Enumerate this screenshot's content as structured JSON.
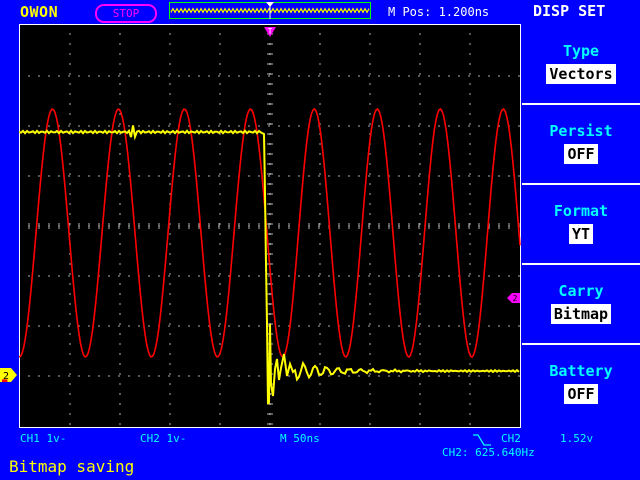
{
  "header": {
    "brand": "OWON",
    "run_status": "STOP",
    "m_pos": "M Pos: 1.200ns",
    "menu_title": "DISP SET"
  },
  "menu": [
    {
      "label": "Type",
      "value": "Vectors"
    },
    {
      "label": "Persist",
      "value": "OFF"
    },
    {
      "label": "Format",
      "value": "YT"
    },
    {
      "label": "Carry",
      "value": "Bitmap"
    },
    {
      "label": "Battery",
      "value": "OFF"
    }
  ],
  "status_bar": {
    "ch1": "CH1 1v-",
    "ch2": "CH2 1v-",
    "timebase": "M  50ns",
    "trigger_source": "CH2",
    "trigger_level": "1.52v",
    "frequency": "CH2: 625.640Hz"
  },
  "message": "Bitmap saving",
  "markers": {
    "trigger_marker": "T",
    "ch2_level_marker": "2",
    "ch2_ground_marker": "2"
  },
  "colors": {
    "background": "#0000ff",
    "screen": "#000000",
    "ch1_trace": "#ffff00",
    "ch2_trace": "#ff0000",
    "menu_label": "#00ffff",
    "accent_magenta": "#ff00ff"
  }
}
